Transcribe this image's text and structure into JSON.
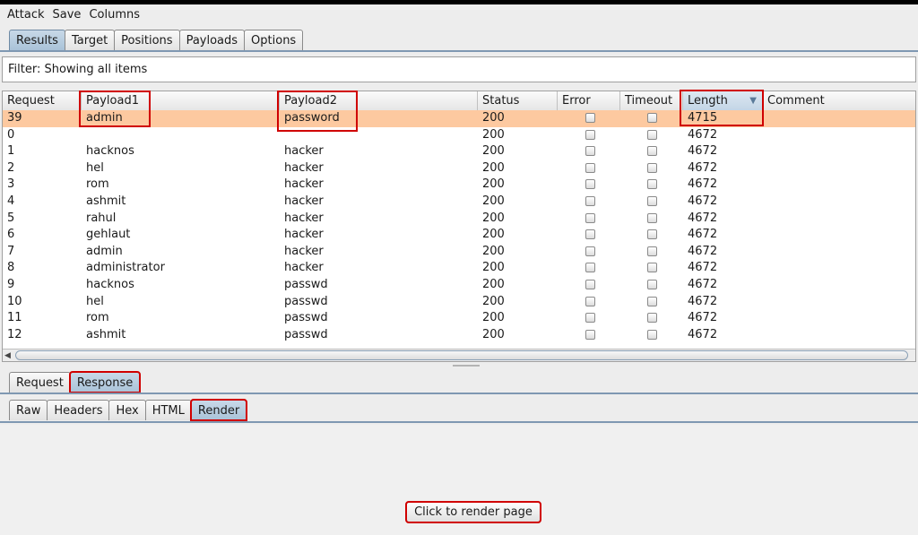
{
  "menu": [
    "Attack",
    "Save",
    "Columns"
  ],
  "main_tabs": [
    {
      "label": "Results",
      "selected": true
    },
    {
      "label": "Target"
    },
    {
      "label": "Positions"
    },
    {
      "label": "Payloads"
    },
    {
      "label": "Options"
    }
  ],
  "filter_text": "Filter: Showing all items",
  "columns": [
    "Request",
    "Payload1",
    "Payload2",
    "Status",
    "Error",
    "Timeout",
    "Length",
    "Comment"
  ],
  "sort_column": "Length",
  "rows": [
    {
      "request": "39",
      "payload1": "admin",
      "payload2": "password",
      "status": "200",
      "length": "4715",
      "selected": true
    },
    {
      "request": "0",
      "payload1": "",
      "payload2": "",
      "status": "200",
      "length": "4672"
    },
    {
      "request": "1",
      "payload1": "hacknos",
      "payload2": "hacker",
      "status": "200",
      "length": "4672"
    },
    {
      "request": "2",
      "payload1": "hel",
      "payload2": "hacker",
      "status": "200",
      "length": "4672"
    },
    {
      "request": "3",
      "payload1": "rom",
      "payload2": "hacker",
      "status": "200",
      "length": "4672"
    },
    {
      "request": "4",
      "payload1": "ashmit",
      "payload2": "hacker",
      "status": "200",
      "length": "4672"
    },
    {
      "request": "5",
      "payload1": "rahul",
      "payload2": "hacker",
      "status": "200",
      "length": "4672"
    },
    {
      "request": "6",
      "payload1": "gehlaut",
      "payload2": "hacker",
      "status": "200",
      "length": "4672"
    },
    {
      "request": "7",
      "payload1": "admin",
      "payload2": "hacker",
      "status": "200",
      "length": "4672"
    },
    {
      "request": "8",
      "payload1": "administrator",
      "payload2": "hacker",
      "status": "200",
      "length": "4672"
    },
    {
      "request": "9",
      "payload1": "hacknos",
      "payload2": "passwd",
      "status": "200",
      "length": "4672"
    },
    {
      "request": "10",
      "payload1": "hel",
      "payload2": "passwd",
      "status": "200",
      "length": "4672"
    },
    {
      "request": "11",
      "payload1": "rom",
      "payload2": "passwd",
      "status": "200",
      "length": "4672"
    },
    {
      "request": "12",
      "payload1": "ashmit",
      "payload2": "passwd",
      "status": "200",
      "length": "4672"
    }
  ],
  "detail_tabs": [
    {
      "label": "Request"
    },
    {
      "label": "Response",
      "selected": true
    }
  ],
  "view_tabs": [
    {
      "label": "Raw"
    },
    {
      "label": "Headers"
    },
    {
      "label": "Hex"
    },
    {
      "label": "HTML"
    },
    {
      "label": "Render",
      "selected": true
    }
  ],
  "render_button": "Click to render page",
  "colors": {
    "selected_row": "#fdc9a0",
    "selected_tab": "#a9c2d8",
    "highlight": "#d00000"
  }
}
